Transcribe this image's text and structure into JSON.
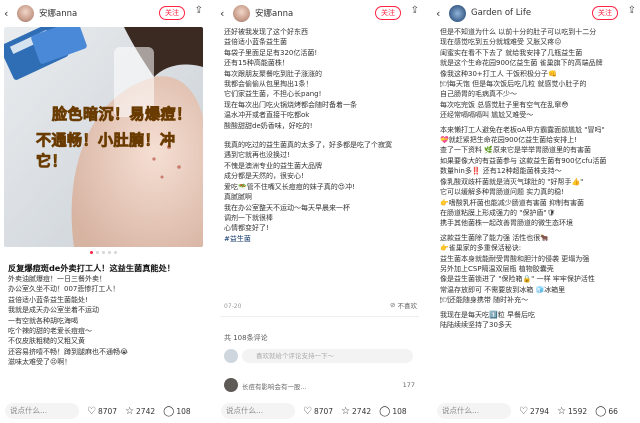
{
  "panels": [
    {
      "user": {
        "name": "安娜anna",
        "follow": "关注"
      },
      "overlay_text": [
        "脸色暗沉！易爆痘！",
        "不通畅！小肚腩！冲它！"
      ],
      "title": "反复爆痘斑de外卖打工人！这益生菌真能处！",
      "lines": [
        "外卖油腻爆痘！一日三餐外卖！",
        "办公室久坐不动！007悲惨打工人！",
        "益倍适小蓝条益生菌能处!",
        "我就是成天办公室坐着不运动",
        "一有空就各种胡吃海喝",
        "吃个辣的甜的老爱长痘痘～",
        "不仅皮肤粗糙的又粗又黄",
        "还容易挤噎不畅！蹲到腿麻也不通畅😭",
        "滋味太难受了😣啊！"
      ],
      "bar": {
        "say": "说点什么...",
        "likes": "8707",
        "stars": "2742",
        "comments": "108"
      }
    },
    {
      "user": {
        "name": "安娜anna",
        "follow": "关注"
      },
      "lines": [
        "还好被我发现了这个好东西",
        "益倍适小蓝条益生菌",
        "每袋子里面足足有320亿活菌!",
        "还有15种高能菌株！",
        "每次跟朋友聚餐吃到肚子涨涨的",
        "我都会偷偷从包里掏出1条！",
        "它们家益生菌，不担心长pang!",
        "现在每次出门吃火锅烧烤都会随时备着一条",
        "温水冲开或者直接干吃都ok",
        "酸酸甜甜de奶香味，好吃的!"
      ],
      "lines2": [
        "我真的吃过的益生菌真的太多了，好多都是吃了个寂寞",
        "遇到它就再也没换过!",
        "不愧是澳洲专业的益生菌大品牌",
        "成分都是天然的，很安心!",
        "爱吃🥗管不住嘴又长痘痘的妹子真的😍冲!",
        "真腻腻啊",
        "我在办公室整天不运动～每天早晨来一杯",
        "调剂一下就很棒",
        "心情都变好了!"
      ],
      "tag": "#益生菌",
      "date": "07-20",
      "notlike": "不喜欢",
      "comment_count": "共 108条评论",
      "comment_placeholder": "喜欢就给个评论支持一下～",
      "comment_preview": "长痘有影响会有一股...",
      "comment_likes": "177",
      "bar": {
        "say": "说点什么...",
        "likes": "8707",
        "stars": "2742",
        "comments": "108"
      }
    },
    {
      "user": {
        "name": "Garden of Life",
        "follow": "关注"
      },
      "lines": [
        "但是不知道为什么 以前十分的肚子可以吃到十二分",
        "现在感觉吃到五分就城难受 又胀又疼😖",
        "闺蜜实在看不下去了 就给我安排了几瓶益生菌",
        "就是这个生命花园900亿益生菌 雀巢旗下的高端品牌",
        "像我这种30+打工人 干饭积极分子👊",
        "🍽每天饱 但是每次饭后吃几粒 就感觉小肚子的",
        "自己肠胃的毛病真不少～",
        "每次吃完饭 总感觉肚子里有空气在乱窜😳",
        "还经常嗝嗝嗝叫 尴尬又难受～"
      ],
      "lines2": [
        "本来懒打工人避免在老板oA甲方霸露面前尴尬 \"冒吗\"",
        "💝就赶紧把生命花园900亿益生菌给安排上!",
        "查了一下资料 🌿原来它是举举胃肠道里的有害菌",
        "如果要像大的有益菌参与 这款益生菌有900亿cfu活菌",
        "数量hin多‼️ 还有12种超能菌株支持～",
        "像乳酸双歧杆菌就是消灭气球肚的 \"好帮手👍\"",
        "它可以缓解多种胃肠道问题 实力真的稳!",
        "👉嗜酸乳杆菌也能减少肠道有害菌 抑制有害菌",
        "在肠道粘膜上形成强力的 \"保护盾\"🛡",
        "携手其他菌株一起改善胃肠道的微生态环境"
      ],
      "lines3": [
        "这款益生菌除了能力强 活性也很🐂",
        "👉雀巢家的多重保活秘诀:",
        "益生菌本身就能耐受胃酸和胆汁的侵袭 更塌为强",
        "另外加上CSP隔温双层瓶 植物胶囊壳",
        "像是益生菌锁进了 \"保险箱🔒\" 一样 牢牢保护活性",
        "常温存放即可 不需要放到冰箱 🧊冰箱里",
        "🍽还能随身携带 随时补充～"
      ],
      "lines4": [
        "我现在是每天吃1️⃣粒 早餐后吃",
        "陆陆续续坚持了30多天"
      ],
      "bar": {
        "say": "说点什么...",
        "likes": "2794",
        "stars": "1592",
        "comments": "66"
      }
    }
  ],
  "colors": {
    "accent": "#ff2442",
    "tag": "#13386c",
    "overlay": "#ffe52b"
  },
  "icons": [
    "back-arrow-icon",
    "share-icon",
    "heart-icon",
    "star-icon",
    "comment-icon",
    "dislike-icon"
  ]
}
